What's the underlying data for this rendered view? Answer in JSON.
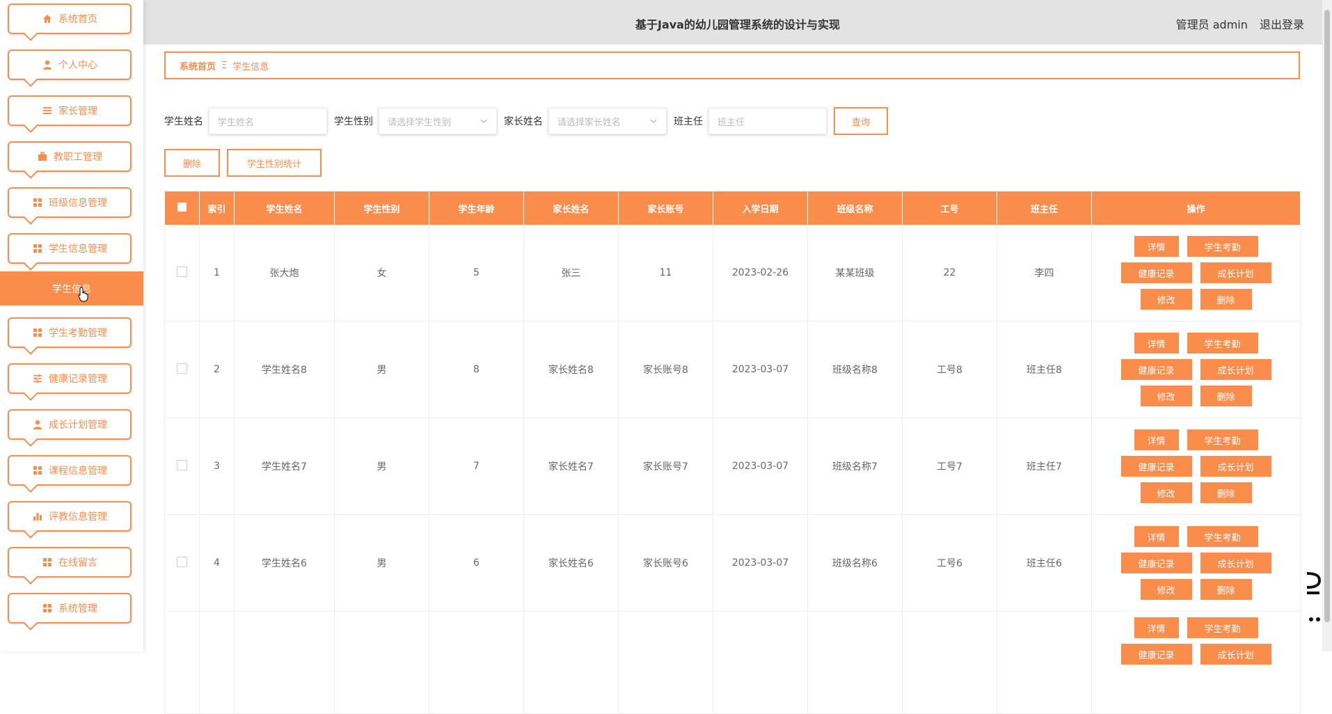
{
  "header": {
    "title": "基于Java的幼儿园管理系统的设计与实现",
    "user": "管理员 admin",
    "logout": "退出登录"
  },
  "sidebar": {
    "items": [
      {
        "label": "系统首页",
        "icon": "home-icon"
      },
      {
        "label": "个人中心",
        "icon": "user-icon"
      },
      {
        "label": "家长管理",
        "icon": "list-icon"
      },
      {
        "label": "教职工管理",
        "icon": "briefcase-icon"
      },
      {
        "label": "班级信息管理",
        "icon": "grid-icon"
      },
      {
        "label": "学生信息管理",
        "icon": "grid-icon"
      },
      {
        "label": "学生考勤管理",
        "icon": "grid-icon"
      },
      {
        "label": "健康记录管理",
        "icon": "sliders-icon"
      },
      {
        "label": "成长计划管理",
        "icon": "user-icon"
      },
      {
        "label": "课程信息管理",
        "icon": "grid-icon"
      },
      {
        "label": "评教信息管理",
        "icon": "bar-chart-icon"
      },
      {
        "label": "在线留言",
        "icon": "grid-icon"
      },
      {
        "label": "系统管理",
        "icon": "grid-icon"
      }
    ],
    "active_sub": "学生信息"
  },
  "breadcrumb": {
    "home": "系统首页",
    "separator": "Ξ",
    "current": "学生信息"
  },
  "search": {
    "name_label": "学生姓名",
    "name_placeholder": "学生姓名",
    "gender_label": "学生性别",
    "gender_placeholder": "请选择学生性别",
    "parent_label": "家长姓名",
    "parent_placeholder": "请选择家长姓名",
    "teacher_label": "班主任",
    "teacher_placeholder": "班主任",
    "query_button": "查询"
  },
  "actions": {
    "delete": "删除",
    "gender_stats": "学生性别统计"
  },
  "table": {
    "columns": [
      "索引",
      "学生姓名",
      "学生性别",
      "学生年龄",
      "家长姓名",
      "家长账号",
      "入学日期",
      "班级名称",
      "工号",
      "班主任",
      "操作"
    ],
    "op_labels": {
      "detail": "详情",
      "attendance": "学生考勤",
      "health": "健康记录",
      "growth": "成长计划",
      "edit": "修改",
      "delete": "删除"
    },
    "rows": [
      {
        "index": "1",
        "name": "张大炮",
        "gender": "女",
        "age": "5",
        "parent": "张三",
        "account": "11",
        "date": "2023-02-26",
        "class": "某某班级",
        "staff_no": "22",
        "teacher": "李四"
      },
      {
        "index": "2",
        "name": "学生姓名8",
        "gender": "男",
        "age": "8",
        "parent": "家长姓名8",
        "account": "家长账号8",
        "date": "2023-03-07",
        "class": "班级名称8",
        "staff_no": "工号8",
        "teacher": "班主任8"
      },
      {
        "index": "3",
        "name": "学生姓名7",
        "gender": "男",
        "age": "7",
        "parent": "家长姓名7",
        "account": "家长账号7",
        "date": "2023-03-07",
        "class": "班级名称7",
        "staff_no": "工号7",
        "teacher": "班主任7"
      },
      {
        "index": "4",
        "name": "学生姓名6",
        "gender": "男",
        "age": "6",
        "parent": "家长姓名6",
        "account": "家长账号6",
        "date": "2023-03-07",
        "class": "班级名称6",
        "staff_no": "工号6",
        "teacher": "班主任6"
      }
    ]
  },
  "colors": {
    "accent": "#fb8d4c",
    "header_bg": "#e3e3e3"
  }
}
